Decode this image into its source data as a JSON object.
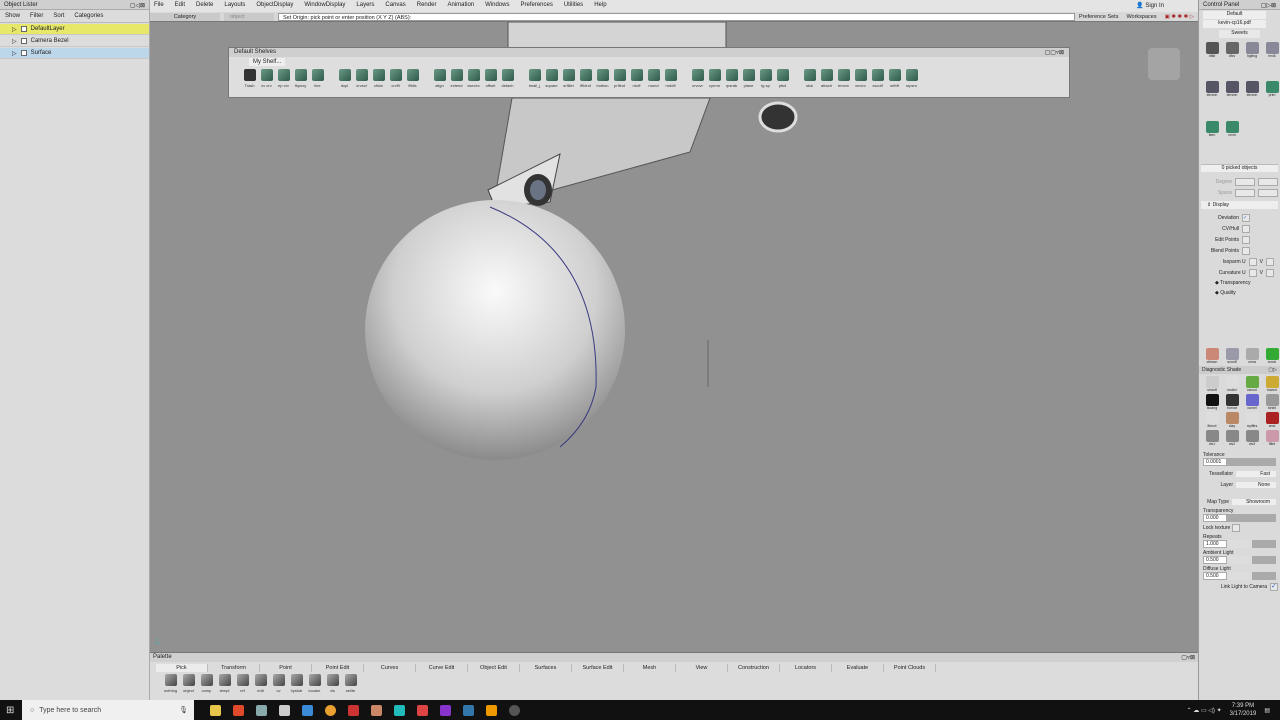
{
  "object_lister": {
    "title": "Object Lister",
    "menu": [
      "Show",
      "Filter",
      "Sort",
      "Categories"
    ],
    "layers": [
      {
        "name": "DefaultLayer"
      },
      {
        "name": "Camera Bezel"
      },
      {
        "name": "Surface"
      }
    ]
  },
  "menubar": [
    "File",
    "Edit",
    "Delete",
    "Layouts",
    "ObjectDisplay",
    "WindowDisplay",
    "Layers",
    "Canvas",
    "Render",
    "Animation",
    "Windows",
    "Preferences",
    "Utilities",
    "Help"
  ],
  "sign_in": "Sign In",
  "toolbar": {
    "category": "Category",
    "object": "object",
    "prompt": "Set Origin: pick point or enter position (X Y Z) (ABS):",
    "preference_sets": "Preference Sets",
    "workspaces": "Workspaces"
  },
  "shelf": {
    "title": "Default Shelves",
    "tab": "My Shelf...",
    "groups": [
      [
        "Trash",
        "cv crv",
        "ep crv",
        "fkpoxy",
        "line"
      ],
      [
        "dupl",
        "crvsct",
        "cfslw",
        "crvfll",
        "ffblls"
      ],
      [
        "align",
        "extend",
        "xsecec",
        "offset",
        "detach"
      ],
      [
        "tmall_j",
        "square",
        "srflllet",
        "fflblnd",
        "bulbon",
        "prfllnd",
        "rdoff",
        "round",
        "rnddfl"
      ],
      [
        "crvcvr",
        "cyrmn",
        "rpsrab",
        "plane",
        "tg sp",
        "pfsd"
      ],
      [
        "stck",
        "attach",
        "trmcrv",
        "xmcrv",
        "xscoff",
        "srfbff",
        "srpsrn"
      ]
    ]
  },
  "control_panel": {
    "title": "Control Panel",
    "preset": "Default",
    "file": "kevin-cp16.pdf",
    "shelf_tab": "Sweets",
    "icons": [
      "dfkit",
      "dfcv",
      "hglkvg",
      "mvlk",
      "xtrnmn",
      "xtrnmn",
      "xtrnmn",
      "prim",
      "fsen",
      "crvm"
    ],
    "picked": "0 picked objects",
    "degree": "Degree",
    "spans": "Spans",
    "display": "Display",
    "options": [
      {
        "label": "Deviation",
        "checked": true
      },
      {
        "label": "CV/Hull",
        "checked": false
      },
      {
        "label": "Edit Points",
        "checked": false
      },
      {
        "label": "Blend Points",
        "checked": false
      },
      {
        "label": "Isoparm U",
        "checked": false,
        "v": "V"
      },
      {
        "label": "Curvature U",
        "checked": false,
        "v": "V"
      }
    ],
    "sub": [
      "Transparency",
      "Quality"
    ],
    "row_icons": [
      "clrlwcn",
      "scnoff",
      "cmra",
      "crcolr"
    ],
    "diag_title": "Diagnostic Shade",
    "diag_icons": [
      "shdoff",
      "multcl",
      "rancol",
      "lowcol",
      "isoang",
      "horvar",
      "curvel",
      "stnlnl",
      "flmcvl",
      "clay",
      "rcpfltrs",
      "xmd",
      "vis1",
      "vis2",
      "vis3",
      "fillet"
    ],
    "tolerance_label": "Tolerance",
    "tolerance": "0.0001",
    "tessellator_label": "Tessellator",
    "tessellator": "Fast",
    "layer_label": "Layer",
    "layer": "None",
    "map_type_label": "Map Type",
    "map_type": "Showroom",
    "transparency_label": "Transparency",
    "transparency": "0.000",
    "lock_texture": "Lock texture",
    "repeats_label": "Repeats",
    "repeats": "1.000",
    "ambient_label": "Ambient Light",
    "ambient": "0.500",
    "diffuse_label": "Diffuse Light",
    "diffuse": "0.500",
    "link_light": "Link Light to Camera"
  },
  "palette": {
    "title": "Palette",
    "tabs": [
      "Pick",
      "Transform",
      "Point",
      "Point Edit",
      "Curves",
      "Curve Edit",
      "Object Edit",
      "Surfaces",
      "Surface Edit",
      "Mesh",
      "View",
      "Construction",
      "Locators",
      "Evaluate",
      "Point Clouds"
    ],
    "tools": [
      "nothing",
      "object",
      "comp",
      "templ",
      "ref",
      "edit",
      "cv",
      "hyskdr",
      "locator",
      "vis",
      "sel/te"
    ]
  },
  "taskbar": {
    "search": "Type here to search",
    "time": "7:39 PM",
    "date": "3/17/2019"
  }
}
